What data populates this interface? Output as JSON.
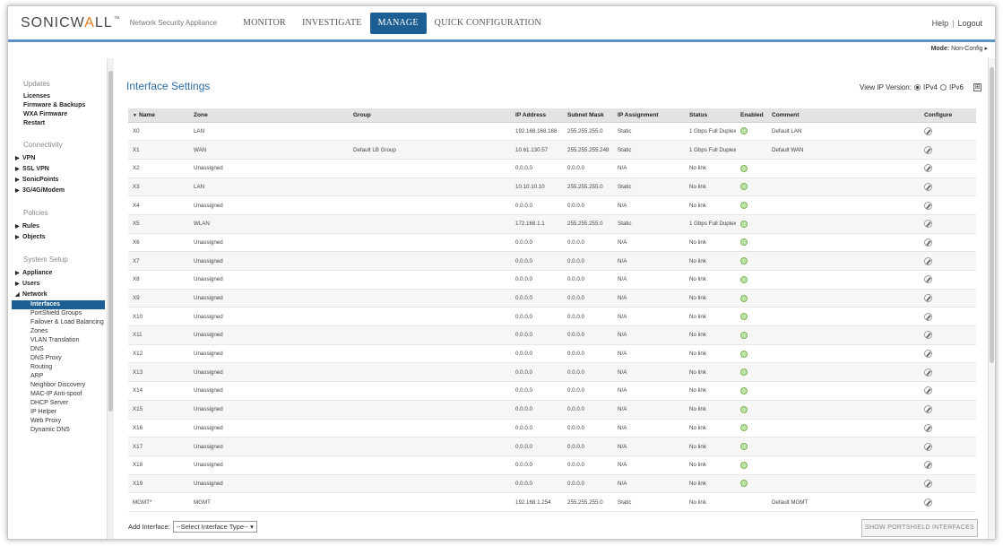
{
  "brand": {
    "logo_main": "SONICW",
    "logo_accent": "A",
    "logo_end": "LL",
    "product": "Network Security Appliance"
  },
  "nav": [
    "MONITOR",
    "INVESTIGATE",
    "MANAGE",
    "QUICK CONFIGURATION"
  ],
  "nav_active": "MANAGE",
  "toplinks": {
    "help": "Help",
    "logout": "Logout"
  },
  "mode": {
    "label": "Mode:",
    "value": "Non-Config ▸"
  },
  "sidebar": [
    {
      "kind": "section",
      "label": "Updates"
    },
    {
      "kind": "link",
      "label": "Licenses"
    },
    {
      "kind": "link",
      "label": "Firmware & Backups"
    },
    {
      "kind": "link",
      "label": "WXA Firmware"
    },
    {
      "kind": "link",
      "label": "Restart"
    },
    {
      "kind": "section",
      "label": "Connectivity"
    },
    {
      "kind": "group",
      "label": "VPN"
    },
    {
      "kind": "group",
      "label": "SSL VPN"
    },
    {
      "kind": "group",
      "label": "SonicPoints"
    },
    {
      "kind": "group",
      "label": "3G/4G/Modem"
    },
    {
      "kind": "section",
      "label": "Policies"
    },
    {
      "kind": "group",
      "label": "Rules"
    },
    {
      "kind": "group",
      "label": "Objects"
    },
    {
      "kind": "section",
      "label": "System Setup"
    },
    {
      "kind": "group",
      "label": "Appliance"
    },
    {
      "kind": "group",
      "label": "Users"
    },
    {
      "kind": "group-open",
      "label": "Network"
    },
    {
      "kind": "sub-active",
      "label": "Interfaces"
    },
    {
      "kind": "sub",
      "label": "PortShield Groups"
    },
    {
      "kind": "sub",
      "label": "Failover & Load Balancing"
    },
    {
      "kind": "sub",
      "label": "Zones"
    },
    {
      "kind": "sub",
      "label": "VLAN Translation"
    },
    {
      "kind": "sub",
      "label": "DNS"
    },
    {
      "kind": "sub",
      "label": "DNS Proxy"
    },
    {
      "kind": "sub",
      "label": "Routing"
    },
    {
      "kind": "sub",
      "label": "ARP"
    },
    {
      "kind": "sub",
      "label": "Neighbor Discovery"
    },
    {
      "kind": "sub",
      "label": "MAC-IP Anti-spoof"
    },
    {
      "kind": "sub",
      "label": "DHCP Server"
    },
    {
      "kind": "sub",
      "label": "IP Helper"
    },
    {
      "kind": "sub",
      "label": "Web Proxy"
    },
    {
      "kind": "sub",
      "label": "Dynamic DNS"
    }
  ],
  "page": {
    "title": "Interface Settings",
    "ip_version_label": "View IP Version:",
    "ipv4": "IPv4",
    "ipv6": "IPv6",
    "selected": "IPv4"
  },
  "table": {
    "columns": [
      "Name",
      "Zone",
      "Group",
      "IP Address",
      "Subnet Mask",
      "IP Assignment",
      "Status",
      "Enabled",
      "Comment",
      "Configure"
    ],
    "rows": [
      {
        "name": "X0",
        "zone": "LAN",
        "group": "",
        "ip": "192.168.168.168",
        "mask": "255.255.255.0",
        "assign": "Static",
        "status": "1 Gbps Full Duplex",
        "enabled": true,
        "comment": "Default LAN"
      },
      {
        "name": "X1",
        "zone": "WAN",
        "group": "Default LB Group",
        "ip": "10.61.130.57",
        "mask": "255.255.255.248",
        "assign": "Static",
        "status": "1 Gbps Full Duplex",
        "enabled": false,
        "comment": "Default WAN"
      },
      {
        "name": "X2",
        "zone": "Unassigned",
        "group": "",
        "ip": "0.0.0.0",
        "mask": "0.0.0.0",
        "assign": "N/A",
        "status": "No link",
        "enabled": true,
        "comment": ""
      },
      {
        "name": "X3",
        "zone": "LAN",
        "group": "",
        "ip": "10.10.10.10",
        "mask": "255.255.255.0",
        "assign": "Static",
        "status": "No link",
        "enabled": true,
        "comment": ""
      },
      {
        "name": "X4",
        "zone": "Unassigned",
        "group": "",
        "ip": "0.0.0.0",
        "mask": "0.0.0.0",
        "assign": "N/A",
        "status": "No link",
        "enabled": true,
        "comment": ""
      },
      {
        "name": "X5",
        "zone": "WLAN",
        "group": "",
        "ip": "172.168.1.1",
        "mask": "255.255.255.0",
        "assign": "Static",
        "status": "1 Gbps Full Duplex",
        "enabled": true,
        "comment": ""
      },
      {
        "name": "X6",
        "zone": "Unassigned",
        "group": "",
        "ip": "0.0.0.0",
        "mask": "0.0.0.0",
        "assign": "N/A",
        "status": "No link",
        "enabled": true,
        "comment": ""
      },
      {
        "name": "X7",
        "zone": "Unassigned",
        "group": "",
        "ip": "0.0.0.0",
        "mask": "0.0.0.0",
        "assign": "N/A",
        "status": "No link",
        "enabled": true,
        "comment": ""
      },
      {
        "name": "X8",
        "zone": "Unassigned",
        "group": "",
        "ip": "0.0.0.0",
        "mask": "0.0.0.0",
        "assign": "N/A",
        "status": "No link",
        "enabled": true,
        "comment": ""
      },
      {
        "name": "X9",
        "zone": "Unassigned",
        "group": "",
        "ip": "0.0.0.0",
        "mask": "0.0.0.0",
        "assign": "N/A",
        "status": "No link",
        "enabled": true,
        "comment": ""
      },
      {
        "name": "X10",
        "zone": "Unassigned",
        "group": "",
        "ip": "0.0.0.0",
        "mask": "0.0.0.0",
        "assign": "N/A",
        "status": "No link",
        "enabled": true,
        "comment": ""
      },
      {
        "name": "X11",
        "zone": "Unassigned",
        "group": "",
        "ip": "0.0.0.0",
        "mask": "0.0.0.0",
        "assign": "N/A",
        "status": "No link",
        "enabled": true,
        "comment": ""
      },
      {
        "name": "X12",
        "zone": "Unassigned",
        "group": "",
        "ip": "0.0.0.0",
        "mask": "0.0.0.0",
        "assign": "N/A",
        "status": "No link",
        "enabled": true,
        "comment": ""
      },
      {
        "name": "X13",
        "zone": "Unassigned",
        "group": "",
        "ip": "0.0.0.0",
        "mask": "0.0.0.0",
        "assign": "N/A",
        "status": "No link",
        "enabled": true,
        "comment": ""
      },
      {
        "name": "X14",
        "zone": "Unassigned",
        "group": "",
        "ip": "0.0.0.0",
        "mask": "0.0.0.0",
        "assign": "N/A",
        "status": "No link",
        "enabled": true,
        "comment": ""
      },
      {
        "name": "X15",
        "zone": "Unassigned",
        "group": "",
        "ip": "0.0.0.0",
        "mask": "0.0.0.0",
        "assign": "N/A",
        "status": "No link",
        "enabled": true,
        "comment": ""
      },
      {
        "name": "X16",
        "zone": "Unassigned",
        "group": "",
        "ip": "0.0.0.0",
        "mask": "0.0.0.0",
        "assign": "N/A",
        "status": "No link",
        "enabled": true,
        "comment": ""
      },
      {
        "name": "X17",
        "zone": "Unassigned",
        "group": "",
        "ip": "0.0.0.0",
        "mask": "0.0.0.0",
        "assign": "N/A",
        "status": "No link",
        "enabled": true,
        "comment": ""
      },
      {
        "name": "X18",
        "zone": "Unassigned",
        "group": "",
        "ip": "0.0.0.0",
        "mask": "0.0.0.0",
        "assign": "N/A",
        "status": "No link",
        "enabled": true,
        "comment": ""
      },
      {
        "name": "X19",
        "zone": "Unassigned",
        "group": "",
        "ip": "0.0.0.0",
        "mask": "0.0.0.0",
        "assign": "N/A",
        "status": "No link",
        "enabled": true,
        "comment": ""
      },
      {
        "name": "MGMT*",
        "zone": "MGMT",
        "group": "",
        "ip": "192.168.1.254",
        "mask": "255.255.255.0",
        "assign": "Static",
        "status": "No link",
        "enabled": false,
        "comment": "Default MGMT"
      }
    ]
  },
  "footer": {
    "add_label": "Add Interface:",
    "select_value": "--Select Interface Type--",
    "show_button": "SHOW PORTSHIELD INTERFACES"
  },
  "colors": {
    "accent": "#1e5f93",
    "title": "#2d6aa0",
    "logo_accent": "#e8791e",
    "header_rule": "#5d93c4"
  }
}
